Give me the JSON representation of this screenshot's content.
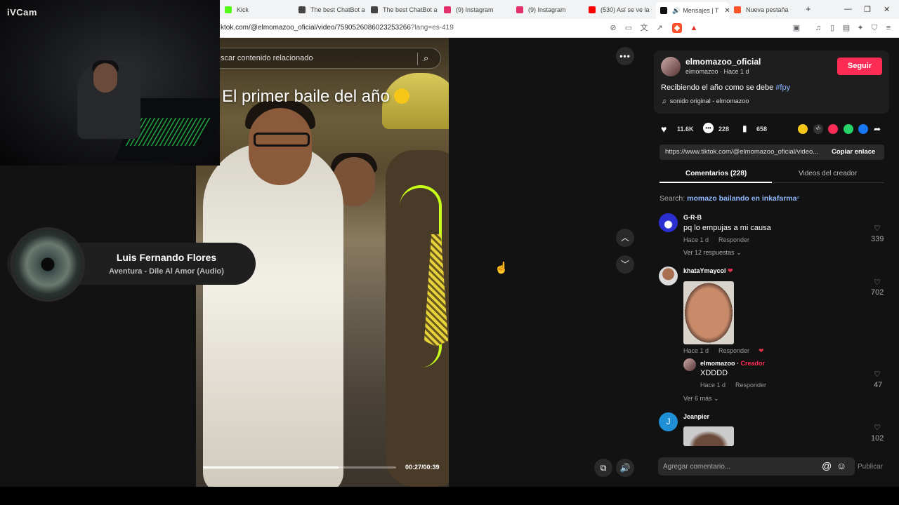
{
  "browser": {
    "tabs": [
      {
        "label": "Kick",
        "color": "#53fc18"
      },
      {
        "label": "The best ChatBot a",
        "color": "#444444"
      },
      {
        "label": "The best ChatBot a",
        "color": "#444444"
      },
      {
        "label": "(9) Instagram",
        "color": "#e1306c"
      },
      {
        "label": "(9) Instagram",
        "color": "#e1306c"
      },
      {
        "label": "(530) Así se ve la m",
        "color": "#ff0000"
      },
      {
        "label": "Mensajes | T",
        "color": "#111111"
      },
      {
        "label": "Nueva pestaña",
        "color": "#fb542b"
      }
    ],
    "new_tab": "+",
    "url_main": "ktok.com/@elmomazoo_oficial/video/7590526086023253266",
    "url_query": "?lang=es-419"
  },
  "webcam": {
    "brand": "iVCam"
  },
  "now_playing": {
    "artist": "Luis Fernando Flores",
    "track": "Aventura - Dile Al Amor (Audio)"
  },
  "video": {
    "search_placeholder": "scar contenido relacionado",
    "caption": "El primer baile del año",
    "caption_emoji": "😂",
    "progress_fraction": 0.7,
    "time": "00:27/00:39"
  },
  "panel": {
    "username": "elmomazoo_oficial",
    "handle_time": "elmomazoo · Hace 1 d",
    "follow_label": "Seguir",
    "description": "Recibiendo el año como se debe",
    "hashtag": "#fpy",
    "sound": "sonido original - elmomazoo",
    "likes": "11.6K",
    "comments_count": "228",
    "saves": "658",
    "link": "https://www.tiktok.com/@elmomazoo_oficial/video...",
    "copy_label": "Copiar enlace",
    "tab_comments": "Comentarios (228)",
    "tab_videos": "Videos del creador",
    "search_prefix": "Search:",
    "search_term": "momazo bailando en inkafarma",
    "comment_placeholder": "Agregar comentario...",
    "publish_label": "Publicar"
  },
  "comments": [
    {
      "user": "G-R-B",
      "text": "pq lo empujas a mi causa",
      "time": "Hace 1 d",
      "reply": "Responder",
      "likes": "339",
      "more": "Ver 12 respuestas"
    },
    {
      "user": "khataYmaycol",
      "text": "",
      "time": "Hace 1 d",
      "reply": "Responder",
      "likes": "702",
      "more": ""
    },
    {
      "user": "elmomazoo",
      "badge": "Creador",
      "text": "XDDDD",
      "time": "Hace 1 d",
      "reply": "Responder",
      "likes": "47",
      "more": "Ver 6 más"
    },
    {
      "user": "Jeanpier",
      "avatar_letter": "J",
      "text": "",
      "likes": "102"
    }
  ]
}
